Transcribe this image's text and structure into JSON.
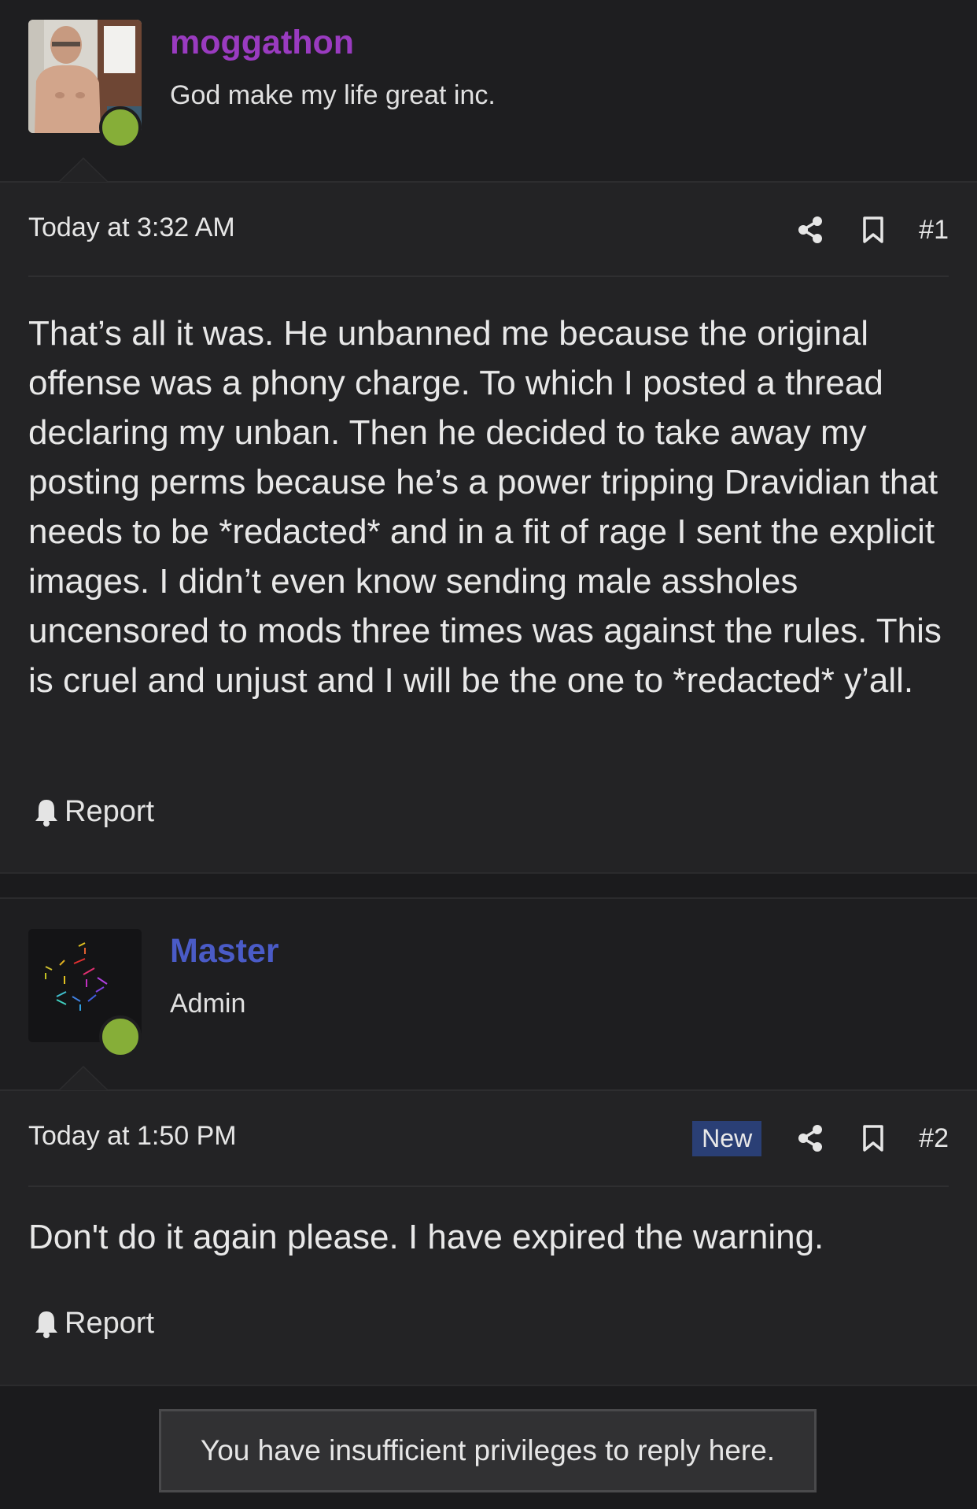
{
  "posts": [
    {
      "username": "moggathon",
      "username_color": "#9a3bc0",
      "user_title": "God make my life great inc.",
      "online_status_color": "#86ae38",
      "avatar": "user-photo-avatar",
      "timestamp": "Today at 3:32 AM",
      "post_number": "#1",
      "body": "That’s all it was. He unbanned me because the original offense was a phony charge. To which I posted a thread declaring my unban. Then he decided to take away my posting perms because he’s a power tripping Dravidian that needs to be *redacted* and in a fit of rage I sent the explicit images. I didn’t even know sending male assholes uncensored to mods three times was against the rules. This is cruel and unjust and I will be the one to *redacted* y’all.",
      "report_label": "Report",
      "icons": [
        "share-icon",
        "bookmark-icon",
        "bell-icon"
      ]
    },
    {
      "username": "Master",
      "username_color": "#4a5bc7",
      "user_title": "Admin",
      "online_status_color": "#86ae38",
      "avatar": "abstract-lines-avatar",
      "timestamp": "Today at 1:50 PM",
      "badge": "New",
      "badge_color": "#2a3f75",
      "post_number": "#2",
      "body": "Don't do it again please. I have expired the warning.",
      "report_label": "Report",
      "icons": [
        "share-icon",
        "bookmark-icon",
        "bell-icon"
      ]
    }
  ],
  "footer_notice": "You have insufficient privileges to reply here."
}
